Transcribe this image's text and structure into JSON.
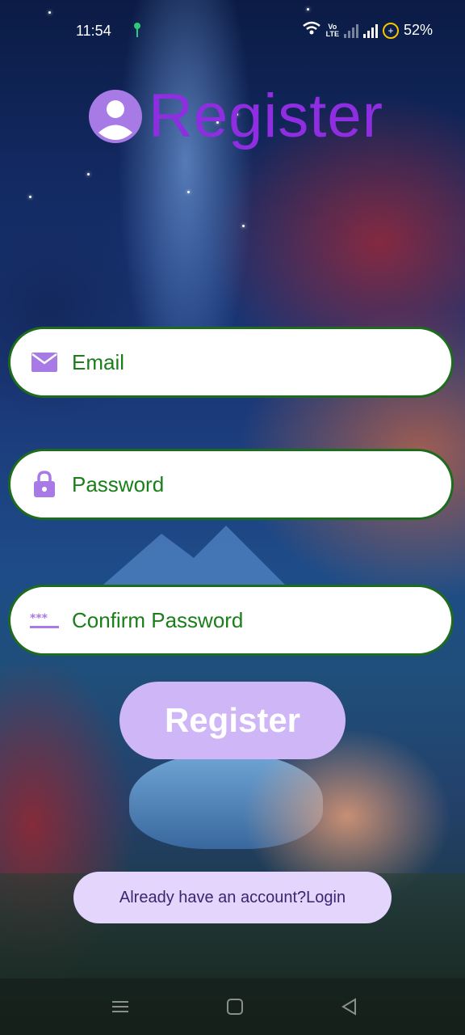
{
  "status_bar": {
    "time": "11:54",
    "volte_label": "Vo\nLTE",
    "battery": "52%"
  },
  "header": {
    "title": "Register",
    "icon": "account-circle-icon"
  },
  "form": {
    "email": {
      "placeholder": "Email",
      "value": "",
      "icon": "mail-icon"
    },
    "password": {
      "placeholder": "Password",
      "value": "",
      "icon": "lock-icon"
    },
    "confirm_password": {
      "placeholder": "Confirm Password",
      "value": "",
      "icon": "password-dots-icon"
    }
  },
  "buttons": {
    "register": "Register",
    "login_link": "Already have an account?Login"
  },
  "navigation": {
    "items": [
      "menu-icon",
      "home-icon",
      "back-icon"
    ]
  },
  "colors": {
    "title": "#8e2ee0",
    "field_border": "#1d6b1d",
    "field_text": "#1a7f1a",
    "icon": "#a77ae6",
    "register_button": "#cfb6f7",
    "login_button": "#e3d5fb"
  }
}
